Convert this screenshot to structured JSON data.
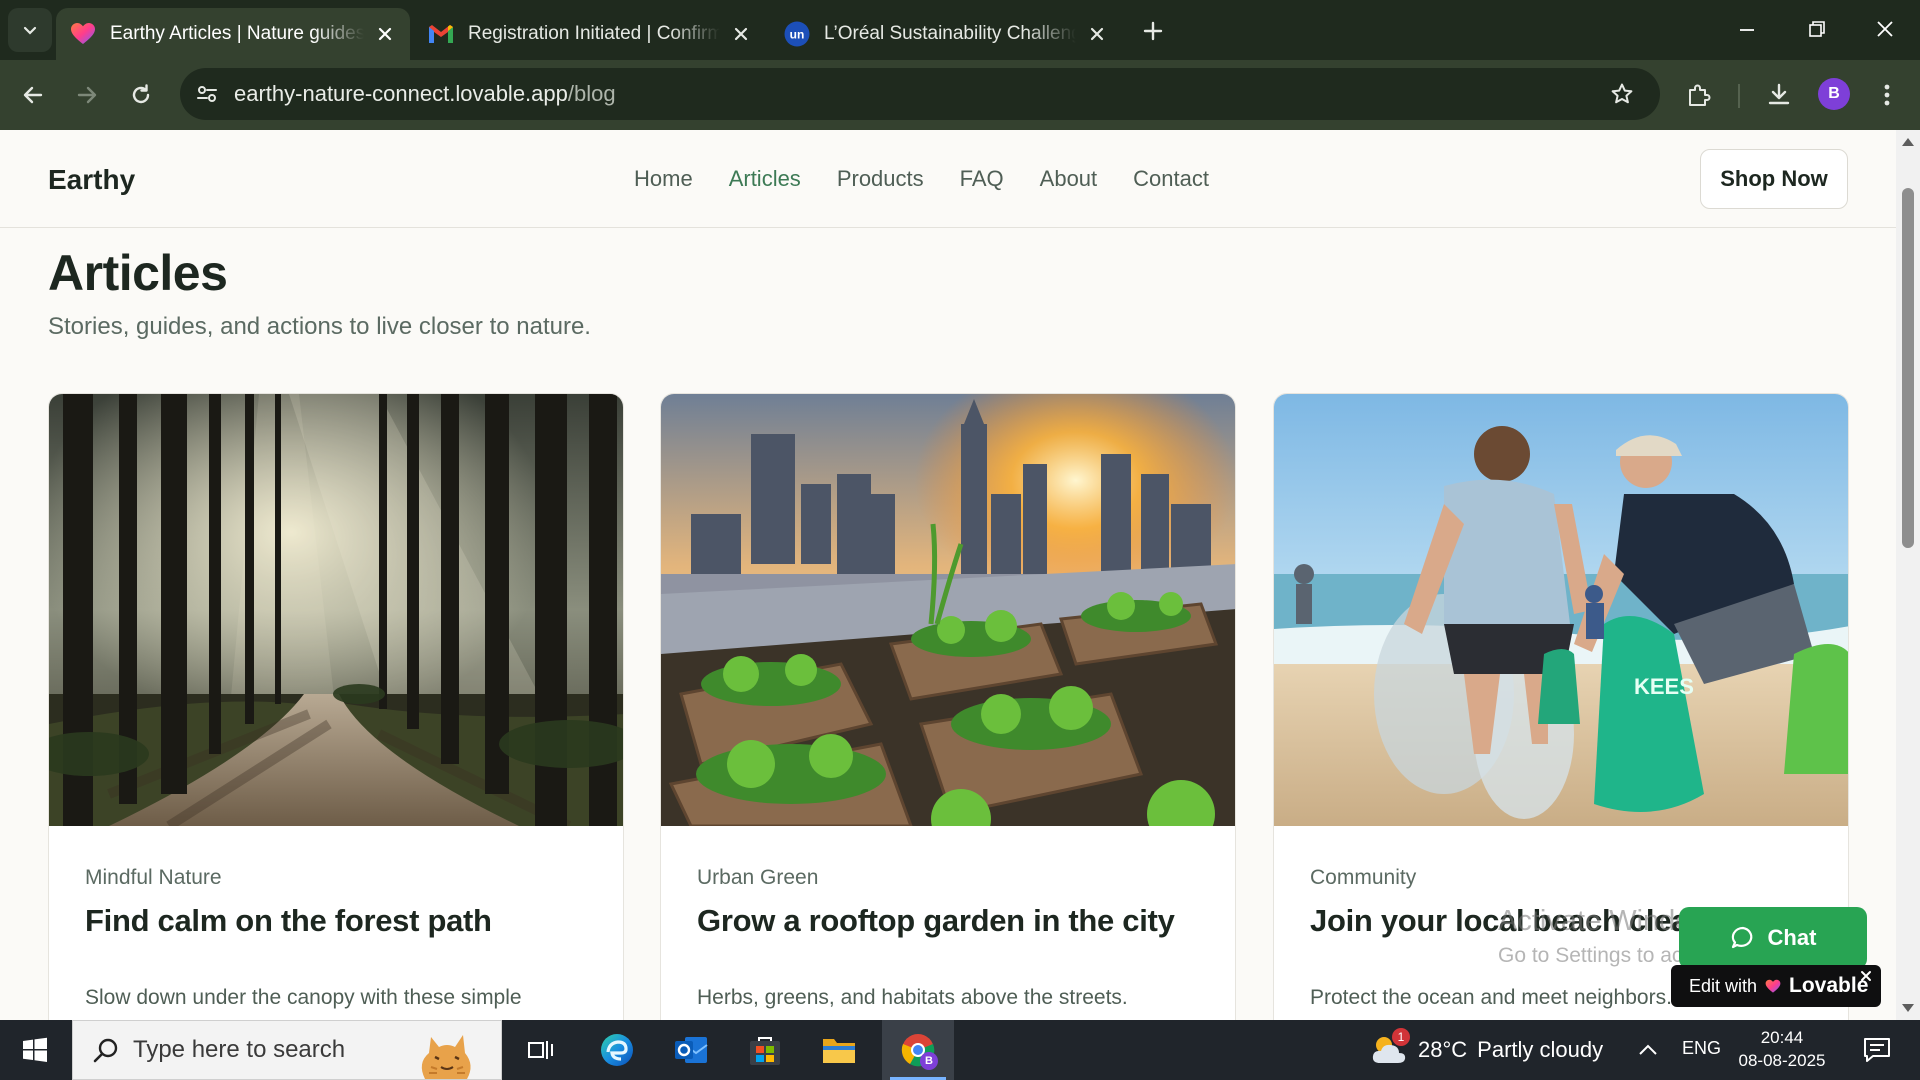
{
  "browser": {
    "tabs": [
      {
        "title": "Earthy Articles | Nature guides & actions",
        "active": true
      },
      {
        "title": "Registration Initiated | Confirmation",
        "active": false
      },
      {
        "title": "L’Oréal Sustainability Challenge",
        "active": false
      }
    ],
    "url_host": "earthy-nature-connect.lovable.app",
    "url_path": "/blog",
    "profile_initial": "B"
  },
  "site": {
    "brand": "Earthy",
    "nav": [
      "Home",
      "Articles",
      "Products",
      "FAQ",
      "About",
      "Contact"
    ],
    "active_nav": "Articles",
    "shop_button": "Shop Now"
  },
  "page": {
    "title": "Articles",
    "subtitle": "Stories, guides, and actions to live closer to nature."
  },
  "articles": [
    {
      "category": "Mindful Nature",
      "title": "Find calm on the forest path",
      "excerpt": "Slow down under the canopy with these simple practices."
    },
    {
      "category": "Urban Green",
      "title": "Grow a rooftop garden in the city",
      "excerpt": "Herbs, greens, and habitats above the streets."
    },
    {
      "category": "Community",
      "title": "Join your local beach cleanup",
      "excerpt": "Protect the ocean and meet neighbors."
    }
  ],
  "widgets": {
    "chat_label": "Chat",
    "lovable_prefix": "Edit with",
    "lovable_brand": "Lovable",
    "watermark_line1": "Activate Windows",
    "watermark_line2": "Go to Settings to activate Windows."
  },
  "taskbar": {
    "search_placeholder": "Type here to search",
    "weather_temp": "28°C",
    "weather_desc": "Partly cloudy",
    "weather_badge": "1",
    "language": "ENG",
    "time": "20:44",
    "date": "08-08-2025"
  },
  "colors": {
    "brand_green": "#3d7a55",
    "chat_green": "#28a453",
    "chrome_dark": "#1f2a1e",
    "chrome_toolbar": "#34412f"
  }
}
